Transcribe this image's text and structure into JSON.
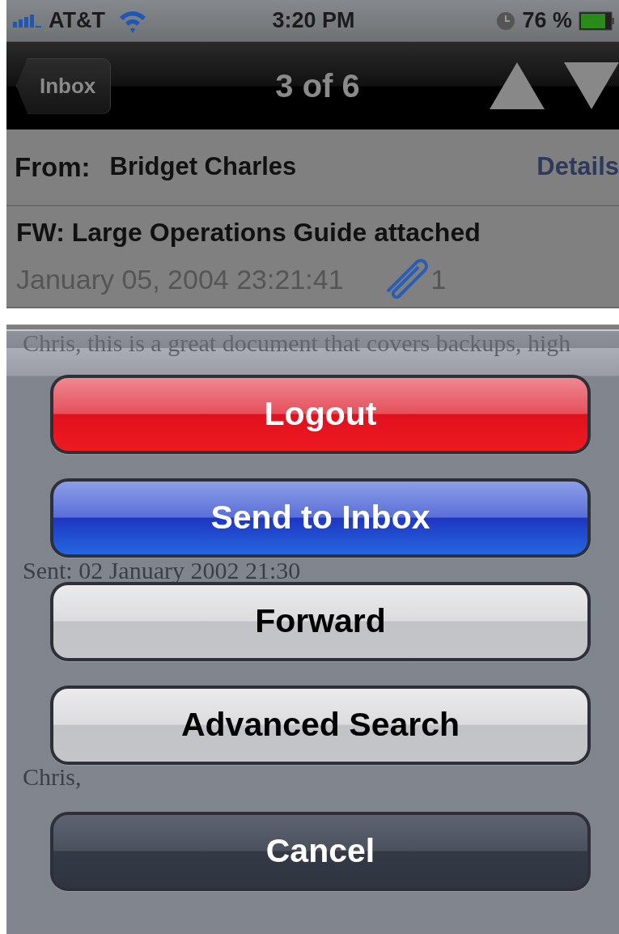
{
  "status_bar": {
    "carrier": "AT&T",
    "time": "3:20 PM",
    "battery": "76 %"
  },
  "nav_bar": {
    "back": "Inbox",
    "title": "3 of 6"
  },
  "message": {
    "from_label": "From:",
    "from": "Bridget Charles",
    "details": "Details",
    "subject": "FW: Large Operations Guide attached",
    "date": "January 05, 2004 23:21:41",
    "attachments": "1",
    "body_lines": [
      "Chris, this is a great document that covers backups, high",
      "Sent: 02 January 2002 21:30",
      "Chris,"
    ]
  },
  "action_sheet": {
    "buttons": [
      {
        "label": "Logout",
        "kind": "destructive"
      },
      {
        "label": "Send to Inbox",
        "kind": "primary"
      },
      {
        "label": "Forward",
        "kind": "default"
      },
      {
        "label": "Advanced Search",
        "kind": "default"
      },
      {
        "label": "Cancel",
        "kind": "cancel"
      }
    ]
  }
}
